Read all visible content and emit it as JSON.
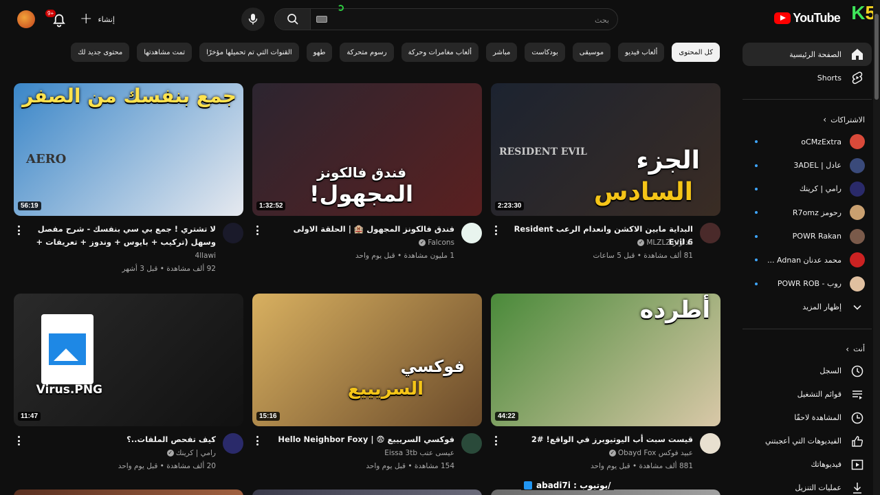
{
  "header": {
    "logo_text": "YouTube",
    "watermark_k": "K",
    "watermark_n": "5",
    "search_placeholder": "بحث",
    "create_label": "إنشاء",
    "notification_count": "9+"
  },
  "chips": [
    {
      "label": "كل المحتوى",
      "active": true
    },
    {
      "label": "ألعاب فيديو"
    },
    {
      "label": "موسيقى"
    },
    {
      "label": "بودكاست"
    },
    {
      "label": "مباشر"
    },
    {
      "label": "ألعاب مغامرات وحركة"
    },
    {
      "label": "رسوم متحركة"
    },
    {
      "label": "طهو"
    },
    {
      "label": "القنوات التي تم تحميلها مؤخرًا"
    },
    {
      "label": "تمت مشاهدتها"
    },
    {
      "label": "محتوى جديد لك"
    }
  ],
  "sidebar": {
    "main": [
      {
        "label": "الصفحة الرئيسية",
        "icon": "home-icon"
      },
      {
        "label": "Shorts",
        "icon": "shorts-icon"
      }
    ],
    "subscriptions_title": "الاشتراكات",
    "subscriptions": [
      {
        "label": "oCMzExtra",
        "color": "#d94a3a"
      },
      {
        "label": "عادل | 3ADEL",
        "color": "#3a4a7a"
      },
      {
        "label": "رامي | كرينك",
        "color": "#2a2a6a"
      },
      {
        "label": "رحومز R7omz",
        "color": "#c9a070"
      },
      {
        "label": "POWR Rakan",
        "color": "#7a5a4a"
      },
      {
        "label": "محمد عدنان Adnan ...",
        "color": "#cc2222"
      },
      {
        "label": "روب - POWR ROB",
        "color": "#e0c0a0"
      }
    ],
    "show_more": "إظهار المزيد",
    "you_title": "أنت",
    "you_items": [
      {
        "label": "السجل",
        "icon": "history-icon"
      },
      {
        "label": "قوائم التشغيل",
        "icon": "playlists-icon"
      },
      {
        "label": "المشاهدة لاحقًا",
        "icon": "watch-later-icon"
      },
      {
        "label": "الفيديوهات التي أعجبتني",
        "icon": "like-icon"
      },
      {
        "label": "فيديوهاتك",
        "icon": "your-videos-icon"
      },
      {
        "label": "عمليات التنزيل",
        "icon": "download-icon"
      }
    ]
  },
  "videos": [
    {
      "title": "البداية مابين الاكشن وانعدام الرعب Resident Evil 6",
      "channel": "مذلزلز MLZLZ",
      "verified": true,
      "stats": "81 ألف مشاهدة • قبل 5 ساعات",
      "duration": "2:23:30",
      "thumb_text": [
        "الجزء",
        "السادس"
      ],
      "thumb_brand": "RESIDENT EVIL",
      "thumb_colors": [
        "#1c2330",
        "#3a2c24"
      ],
      "avatar_color": "#4a2a2a"
    },
    {
      "title": "فندق فالكونز المجهول 🏨 | الحلقة الاولى",
      "channel": "Falcons",
      "verified": true,
      "stats": "1 مليون مشاهدة • قبل يوم واحد",
      "duration": "1:32:52",
      "thumb_text": [
        "فندق فالكونز",
        "المجهول!"
      ],
      "thumb_brand": "",
      "thumb_colors": [
        "#2c2530",
        "#5a2020"
      ],
      "avatar_color": "#e8f4ee"
    },
    {
      "title": "لا تشتري ! جمع بي سي بنفسك - شرح مفصل وسهل (تركيب + بايوس + وندوز + تعريفات + اختبارات)",
      "channel": "4llawi",
      "verified": false,
      "stats": "92 ألف مشاهدة • قبل 3 أشهر",
      "duration": "56:19",
      "thumb_text": [
        "جمع بنفسك من الصفر"
      ],
      "thumb_brand": "AERO",
      "thumb_colors": [
        "#3a86c8",
        "#e6e9ef"
      ],
      "avatar_color": "#1a1a2a"
    },
    {
      "title": "قيست سبت أب اليوتيوبرز في الواقع! #2",
      "channel": "عبيد فوكس Obayd Fox",
      "verified": true,
      "stats": "881 ألف مشاهدة • قبل يوم واحد",
      "duration": "44:22",
      "thumb_text": [
        "أطرده"
      ],
      "thumb_brand": "",
      "thumb_colors": [
        "#4a8a3a",
        "#d9c8a8"
      ],
      "avatar_color": "#e8e0d0"
    },
    {
      "title": "فوكسي السريييع 😨 | Hello Neighbor Foxy",
      "channel": "عيسى عتب Eissa 3tb",
      "verified": false,
      "stats": "154 مشاهدة • قبل يوم واحد",
      "duration": "15:16",
      "thumb_text": [
        "فوكسي",
        "السريييع"
      ],
      "thumb_brand": "",
      "thumb_colors": [
        "#d8b060",
        "#6a4a2a"
      ],
      "avatar_color": "#2a4a3a"
    },
    {
      "title": "كيف تفحص الملفات..؟",
      "channel": "رامي | كرينك",
      "verified": true,
      "stats": "20 ألف مشاهدة • قبل يوم واحد",
      "duration": "11:47",
      "thumb_text": [
        "Virus.PNG"
      ],
      "thumb_brand": "",
      "thumb_colors": [
        "#2a2a2a",
        "#111111"
      ],
      "avatar_color": "#2a2a6a"
    }
  ],
  "overlay": {
    "label": "/يوتيوب : abadi7i"
  }
}
